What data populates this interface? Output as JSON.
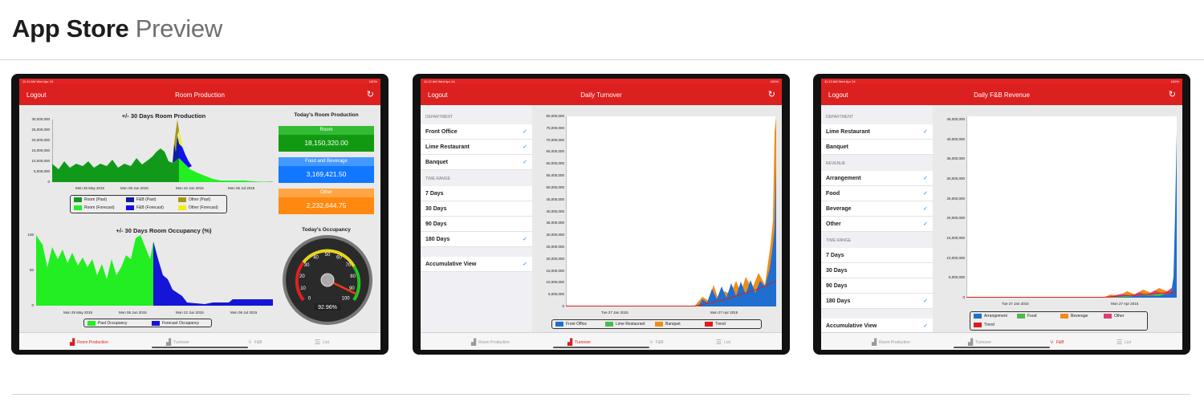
{
  "page": {
    "title_bold": "App Store",
    "title_light": "Preview"
  },
  "shared": {
    "logout": "Logout",
    "status_time": [
      "11:11 AM  Wed Apr 24",
      "11:12 AM  Wed Apr 24",
      "11:13 AM  Wed Apr 24"
    ],
    "battery": "100%",
    "tabs": [
      "Room Production",
      "Turnover",
      "F&B",
      "List"
    ]
  },
  "shot1": {
    "nav_title": "Room Production",
    "chart1": {
      "title": "+/- 30 Days Room Production",
      "yticks": [
        "30,000,000",
        "25,000,000",
        "20,000,000",
        "15,000,000",
        "10,000,000",
        "5,000,000",
        "0"
      ],
      "xticks": [
        "Mon 25 May 2015",
        "Mon 08 Jun 2015",
        "Mon 22 Jun 2015",
        "Mon 06 Jul 2015"
      ],
      "legend": [
        "Room (Past)",
        "F&B (Past)",
        "Other (Past)",
        "Room (Forecast)",
        "F&B (Forecast)",
        "Other (Forecast)"
      ],
      "legend_colors": [
        "#119a1a",
        "#0b1e9c",
        "#a59a13",
        "#22f022",
        "#1010f0",
        "#f0f010"
      ]
    },
    "side_title": "Today's Room Production",
    "cards": [
      {
        "label": "Room",
        "value": "18,150,320.00",
        "c1": "#33bb33",
        "c2": "#119a11"
      },
      {
        "label": "Food and Beverage",
        "value": "3,169,421.50",
        "c1": "#4499ff",
        "c2": "#1177ff"
      },
      {
        "label": "Other",
        "value": "2,232,644.75",
        "c1": "#ffa544",
        "c2": "#ff8811"
      }
    ],
    "chart2": {
      "title": "+/- 30 Days Room Occupancy (%)",
      "yticks": [
        "100",
        "50",
        "0"
      ],
      "xticks": [
        "Mon 25 May 2015",
        "Mon 08 Jun 2015",
        "Mon 22 Jun 2015",
        "Mon 06 Jul 2015"
      ],
      "legend": [
        "Past Occupancy",
        "Forecast Occupancy"
      ],
      "legend_colors": [
        "#22ee22",
        "#1515d8"
      ]
    },
    "gauge": {
      "title": "Today's Occupancy",
      "labels": [
        "0",
        "10",
        "20",
        "30",
        "40",
        "50",
        "60",
        "70",
        "80",
        "90",
        "100"
      ],
      "value": "92.96%",
      "value_num": 92.96
    }
  },
  "shot2": {
    "nav_title": "Daily Turnover",
    "sections": [
      {
        "header": "DEPARTMENT",
        "rows": [
          {
            "label": "Front Office",
            "checked": true
          },
          {
            "label": "Lime Restaurant",
            "checked": true
          },
          {
            "label": "Banquet",
            "checked": true
          }
        ]
      },
      {
        "header": "TIME RANGE",
        "rows": [
          {
            "label": "7 Days",
            "checked": false
          },
          {
            "label": "30 Days",
            "checked": false
          },
          {
            "label": "90 Days",
            "checked": false
          },
          {
            "label": "180 Days",
            "checked": true
          }
        ]
      },
      {
        "header": "",
        "rows": [
          {
            "label": "Accumulative View",
            "checked": true
          }
        ]
      }
    ],
    "yticks": [
      "80,000,000",
      "75,000,000",
      "70,000,000",
      "65,000,000",
      "60,000,000",
      "55,000,000",
      "50,000,000",
      "45,000,000",
      "40,000,000",
      "35,000,000",
      "30,000,000",
      "25,000,000",
      "20,000,000",
      "15,000,000",
      "10,000,000",
      "5,000,000",
      "0"
    ],
    "xticks": [
      "Tue 27 Jan 2015",
      "Mon 27 Apr 2015"
    ],
    "legend": [
      "Front Office",
      "Lime Restaurant",
      "Banquet",
      "Trend"
    ],
    "legend_colors": [
      "#1f6fd0",
      "#4cbb4c",
      "#f08c1a",
      "#e01c1c"
    ]
  },
  "shot3": {
    "nav_title": "Daily F&B Revenue",
    "sections": [
      {
        "header": "DEPARTMENT",
        "rows": [
          {
            "label": "Lime Restaurant",
            "checked": true
          },
          {
            "label": "Banquet",
            "checked": false
          }
        ]
      },
      {
        "header": "REVENUE",
        "rows": [
          {
            "label": "Arrangement",
            "checked": true
          },
          {
            "label": "Food",
            "checked": true
          },
          {
            "label": "Beverage",
            "checked": true
          },
          {
            "label": "Other",
            "checked": true
          }
        ]
      },
      {
        "header": "TIME RANGE",
        "rows": [
          {
            "label": "7 Days",
            "checked": false
          },
          {
            "label": "30 Days",
            "checked": false
          },
          {
            "label": "90 Days",
            "checked": false
          },
          {
            "label": "180 Days",
            "checked": true
          }
        ]
      },
      {
        "header": "",
        "rows": [
          {
            "label": "Accumulative View",
            "checked": true
          }
        ]
      }
    ],
    "yticks": [
      "45,000,000",
      "40,000,000",
      "35,000,000",
      "30,000,000",
      "25,000,000",
      "20,000,000",
      "15,000,000",
      "10,000,000",
      "5,000,000",
      "0"
    ],
    "xticks": [
      "Tue 27 Jan 2015",
      "Mon 27 Apr 2015"
    ],
    "legend": [
      "Arrangement",
      "Food",
      "Beverage",
      "Other",
      "Trend"
    ],
    "legend_colors": [
      "#1f6fd0",
      "#4cbb4c",
      "#f08c1a",
      "#e04070",
      "#e01c1c"
    ]
  }
}
